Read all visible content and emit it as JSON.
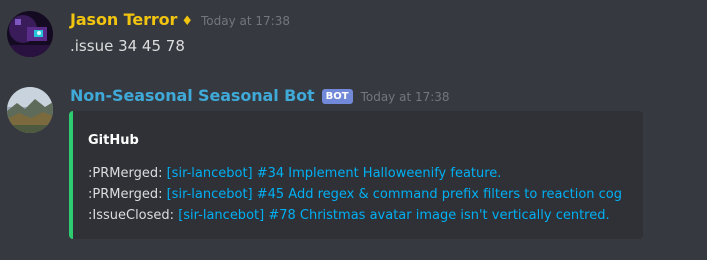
{
  "messages": [
    {
      "username": "Jason Terror",
      "badge": "♦",
      "username_color": "#f1c40f",
      "timestamp": "Today at 17:38",
      "content": ".issue 34 45 78"
    },
    {
      "username": "Non-Seasonal Seasonal Bot",
      "username_color": "#3fa9d8",
      "bot_tag": "BOT",
      "timestamp": "Today at 17:38",
      "embed": {
        "accent_color": "#2ecc71",
        "title": "GitHub",
        "lines": [
          {
            "prefix": ":PRMerged: ",
            "link": "[sir-lancebot] #34 Implement Halloweenify feature."
          },
          {
            "prefix": ":PRMerged: ",
            "link": "[sir-lancebot] #45 Add regex & command prefix filters to reaction cog"
          },
          {
            "prefix": ":IssueClosed: ",
            "link": "[sir-lancebot] #78 Christmas avatar image isn't vertically centred."
          }
        ]
      }
    }
  ]
}
